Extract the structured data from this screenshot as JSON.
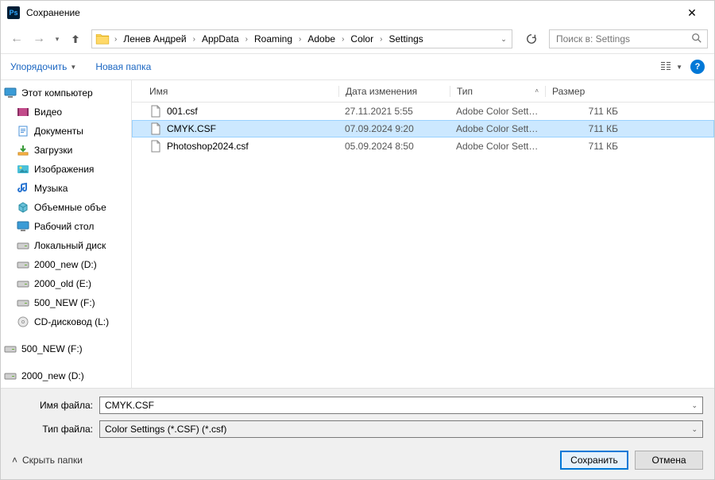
{
  "window": {
    "title": "Сохранение"
  },
  "breadcrumb": {
    "items": [
      "Ленев Андрей",
      "AppData",
      "Roaming",
      "Adobe",
      "Color",
      "Settings"
    ]
  },
  "search": {
    "placeholder": "Поиск в: Settings"
  },
  "toolbar": {
    "organize": "Упорядочить",
    "new_folder": "Новая папка"
  },
  "columns": {
    "name": "Имя",
    "date": "Дата изменения",
    "type": "Тип",
    "size": "Размер"
  },
  "sidebar": {
    "root": "Этот компьютер",
    "items": [
      {
        "label": "Видео",
        "icon": "video"
      },
      {
        "label": "Документы",
        "icon": "docs"
      },
      {
        "label": "Загрузки",
        "icon": "downloads"
      },
      {
        "label": "Изображения",
        "icon": "pictures"
      },
      {
        "label": "Музыка",
        "icon": "music"
      },
      {
        "label": "Объемные объе",
        "icon": "3d"
      },
      {
        "label": "Рабочий стол",
        "icon": "desktop"
      },
      {
        "label": "Локальный диск",
        "icon": "disk"
      },
      {
        "label": "2000_new (D:)",
        "icon": "disk"
      },
      {
        "label": "2000_old (E:)",
        "icon": "disk"
      },
      {
        "label": "500_NEW (F:)",
        "icon": "disk"
      },
      {
        "label": "CD-дисковод (L:)",
        "icon": "cd"
      }
    ],
    "extras": [
      {
        "label": "500_NEW (F:)",
        "icon": "disk"
      },
      {
        "label": "2000_new (D:)",
        "icon": "disk"
      }
    ]
  },
  "files": [
    {
      "name": "001.csf",
      "date": "27.11.2021 5:55",
      "type": "Adobe Color Setti...",
      "size": "711 КБ",
      "selected": false
    },
    {
      "name": "CMYK.CSF",
      "date": "07.09.2024 9:20",
      "type": "Adobe Color Setti...",
      "size": "711 КБ",
      "selected": true
    },
    {
      "name": "Photoshop2024.csf",
      "date": "05.09.2024 8:50",
      "type": "Adobe Color Setti...",
      "size": "711 КБ",
      "selected": false
    }
  ],
  "bottom": {
    "filename_label": "Имя файла:",
    "filename_value": "CMYK.CSF",
    "filetype_label": "Тип файла:",
    "filetype_value": "Color Settings (*.CSF) (*.csf)",
    "hide_folders": "Скрыть папки",
    "save": "Сохранить",
    "cancel": "Отмена"
  }
}
